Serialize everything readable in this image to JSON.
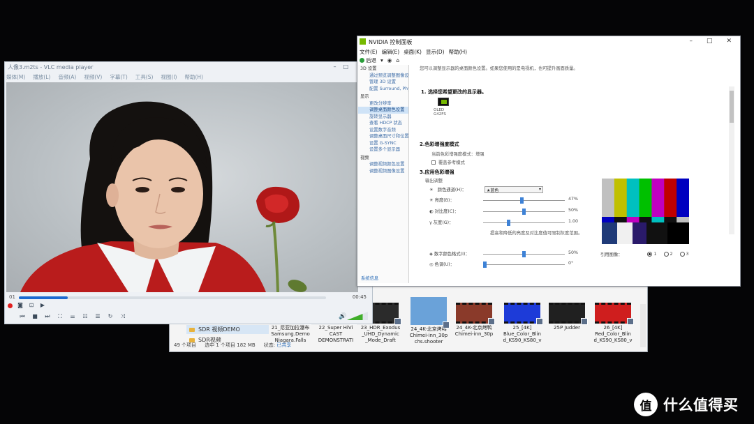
{
  "explorer": {
    "nav": [
      {
        "label": "SDR 视频DEMO",
        "selected": true
      },
      {
        "label": "SDR视频",
        "selected": false
      }
    ],
    "files": [
      {
        "name": "21_尼亚加拉瀑布\nSamsung.Demo\nNiagara.Falls",
        "color": "#3b5a3a"
      },
      {
        "name": "22_Super HiVi\nCAST\nDEMONSTRATI",
        "color": "#6a7f8e"
      },
      {
        "name": "23_HDR_Exodus\n_UHD_Dynamic\n_Mode_Draft",
        "color": "#2b2b2b"
      },
      {
        "name": "24_4K-北京烤鸭\nChimei-inn_30p\nchs.shooter",
        "color": "#6aa2d9"
      },
      {
        "name": "24_4K-北京烤鸭\nChimei-inn_30p",
        "color": "#8a3a2a"
      },
      {
        "name": "25_[4K]\nBlue_Color_Blin\nd_KS90_KS80_v",
        "color": "#1d3bd8"
      },
      {
        "name": "25P Judder",
        "color": "#202020"
      },
      {
        "name": "26_[4K]\nRed_Color_Blin\nd_KS90_KS80_v",
        "color": "#cf1e1e"
      }
    ],
    "status": {
      "count": "49 个项目",
      "selected": "选中 1 个项目  182 MB",
      "state_label": "状态:",
      "state_value": "已共享"
    }
  },
  "vlc": {
    "title": "人像3.m2ts - VLC media player",
    "menu": [
      "媒体(M)",
      "播放(L)",
      "音频(A)",
      "视频(V)",
      "字幕(T)",
      "工具(S)",
      "视图(I)",
      "帮助(H)"
    ],
    "time_elapsed": "01",
    "time_total": "00:45",
    "progress": 0.16,
    "volume": 0.75
  },
  "nvidia": {
    "title": "NVIDIA 控制面板",
    "menu": [
      "文件(E)",
      "编辑(E)",
      "桌面(K)",
      "显示(D)",
      "帮助(H)"
    ],
    "toolbar": {
      "back": "后退"
    },
    "tree": [
      {
        "type": "cat",
        "label": "3D 设置"
      },
      {
        "type": "sub",
        "label": "通过预览调整图像设置"
      },
      {
        "type": "sub",
        "label": "管理 3D 设置"
      },
      {
        "type": "sub",
        "label": "配置 Surround, PhysX"
      },
      {
        "type": "cat",
        "label": "显示"
      },
      {
        "type": "sub",
        "label": "更改分辨率"
      },
      {
        "type": "sub",
        "label": "调整桌面颜色设置",
        "selected": true
      },
      {
        "type": "sub",
        "label": "旋转显示器"
      },
      {
        "type": "sub",
        "label": "查看 HDCP 状态"
      },
      {
        "type": "sub",
        "label": "设置数字音频"
      },
      {
        "type": "sub",
        "label": "调整桌面尺寸和位置"
      },
      {
        "type": "sub",
        "label": "设置 G-SYNC"
      },
      {
        "type": "sub",
        "label": "设置多个显示器"
      },
      {
        "type": "cat",
        "label": "视频"
      },
      {
        "type": "sub",
        "label": "调整视频颜色设置"
      },
      {
        "type": "sub",
        "label": "调整视频图像设置"
      }
    ],
    "system_info": "系统信息",
    "intro": "您可以调整显示器的桌面颜色设置。如果您使用的是电视机，也可提升画面质量。",
    "section1": "1. 选择您希望更改的显示器。",
    "monitor_name": "OLED G42FS",
    "section2": "2.色彩增强度模式",
    "current_mode": "当前色彩增强度模式：增强",
    "reference_mode": "覆盖参考模式",
    "section3": "3.应用色彩增强",
    "output_adjust": "输出调整",
    "channel_label": "颜色通道(H)：",
    "channel_value": "★蓝色",
    "sliders": [
      {
        "icon": "☀",
        "label": "亮度(B)：",
        "value": "47%",
        "pos": 0.47
      },
      {
        "icon": "◐",
        "label": "对比度(C)：",
        "value": "50%",
        "pos": 0.5
      },
      {
        "icon": "γ",
        "label": "灰度(G)：",
        "value": "1.00",
        "pos": 0.3
      }
    ],
    "note": "提高和降低的亮度及对比度值可限制灰度范围。",
    "sliders2": [
      {
        "icon": "◈",
        "label": "数字颜色格式(I)：",
        "value": "50%",
        "pos": 0.5
      },
      {
        "icon": "◎",
        "label": "色调(U)：",
        "value": "0°",
        "pos": 0.0
      }
    ],
    "reference_image_label": "引用图像：",
    "reference_options": [
      "1",
      "2",
      "3"
    ],
    "colorbars": [
      "#c0c0c0",
      "#c0c000",
      "#00c0c0",
      "#00c000",
      "#c000c0",
      "#c00000",
      "#0000c0"
    ]
  },
  "watermark": {
    "icon_char": "值",
    "text": "什么值得买"
  }
}
